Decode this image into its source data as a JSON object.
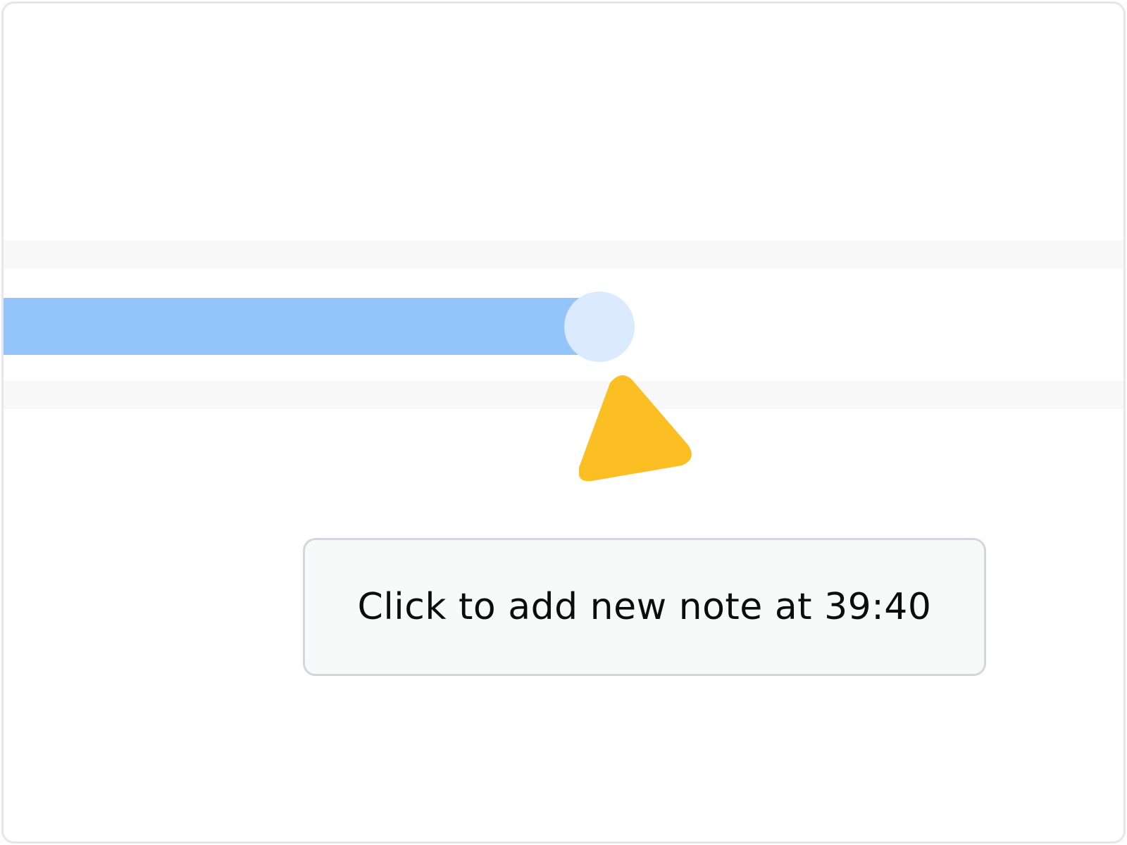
{
  "timeline": {
    "progress_percent": 53,
    "fill_color": "#93c5fb",
    "playhead_color": "#dbeafe"
  },
  "pointer": {
    "icon": "cursor-pointer-icon",
    "color": "#fbbf24"
  },
  "tooltip": {
    "text": "Click to add new note at 39:40"
  }
}
